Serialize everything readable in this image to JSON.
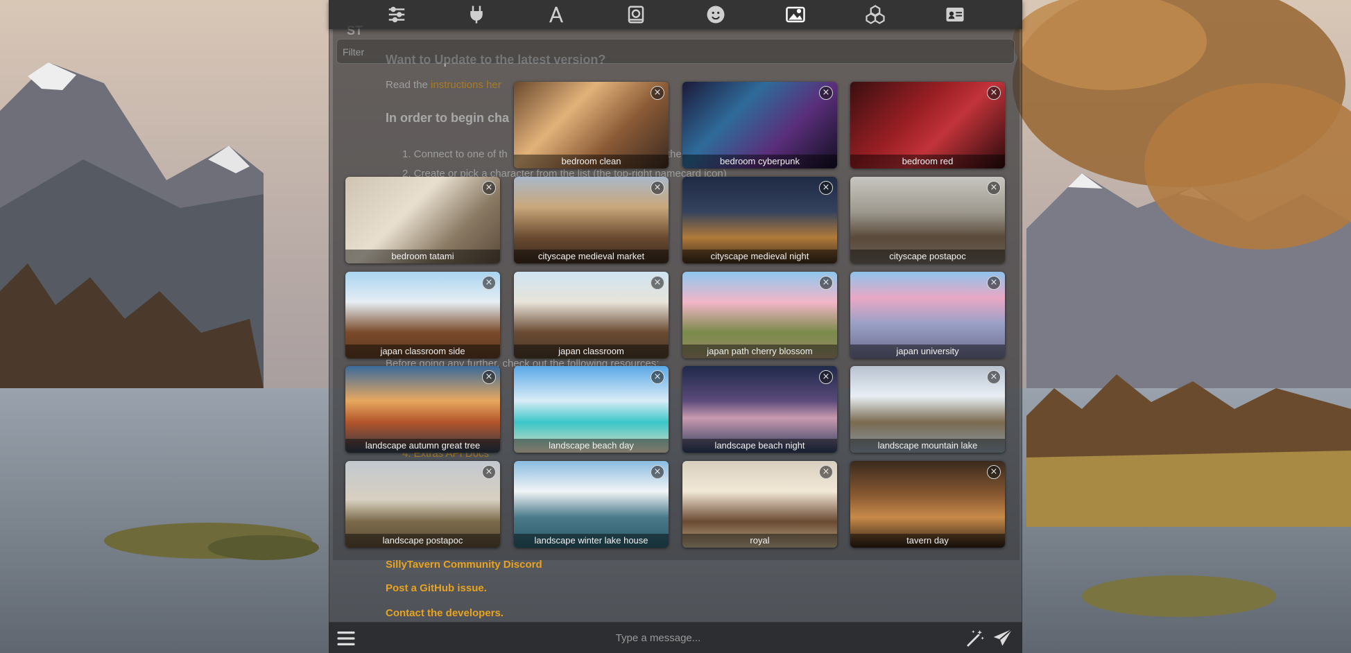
{
  "top_bar": {
    "icons": [
      {
        "name": "ai-response-configuration",
        "icon": "sliders-icon"
      },
      {
        "name": "api-connections",
        "icon": "plug-icon"
      },
      {
        "name": "ai-response-formatting",
        "icon": "font-icon"
      },
      {
        "name": "world-info",
        "icon": "book-atlas-icon"
      },
      {
        "name": "user-settings",
        "icon": "face-smile-icon"
      },
      {
        "name": "change-background",
        "icon": "panorama-icon",
        "active": true
      },
      {
        "name": "extensions",
        "icon": "cubes-icon"
      },
      {
        "name": "character-management",
        "icon": "address-card-icon"
      }
    ]
  },
  "logo": "ST",
  "filter": {
    "placeholder": "Filter"
  },
  "chat": {
    "update_heading": "Want to Update to the latest version?",
    "update_read": "Read the ",
    "update_link": "instructions her",
    "begin_heading": "In order to begin cha",
    "step1": "1. Connect to one of th",
    "step1_tail": "the",
    "step2": "2. Create or pick a character from the list (the top-right namecard icon)",
    "before_going": "Before going any further, check out the following resources:",
    "extras_api": "4. Extras API Docs",
    "community_discord": "SillyTavern Community Discord",
    "github_issue": "Post a GitHub issue.",
    "contact_devs": "Contact the developers."
  },
  "backgrounds": [
    {
      "label": "bedroom clean"
    },
    {
      "label": "bedroom cyberpunk"
    },
    {
      "label": "bedroom red"
    },
    {
      "label": "bedroom tatami"
    },
    {
      "label": "cityscape medieval market"
    },
    {
      "label": "cityscape medieval night"
    },
    {
      "label": "cityscape postapoc"
    },
    {
      "label": "japan classroom side"
    },
    {
      "label": "japan classroom"
    },
    {
      "label": "japan path cherry blossom"
    },
    {
      "label": "japan university"
    },
    {
      "label": "landscape autumn great tree"
    },
    {
      "label": "landscape beach day"
    },
    {
      "label": "landscape beach night"
    },
    {
      "label": "landscape mountain lake"
    },
    {
      "label": "landscape postapoc"
    },
    {
      "label": "landscape winter lake house"
    },
    {
      "label": "royal"
    },
    {
      "label": "tavern day"
    }
  ],
  "close_glyph": "×",
  "bottom_bar": {
    "message_placeholder": "Type a message...",
    "menu_icon": "bars-icon",
    "magic_icon": "wand-magic-sparkles-icon",
    "send_icon": "paper-plane-icon"
  }
}
